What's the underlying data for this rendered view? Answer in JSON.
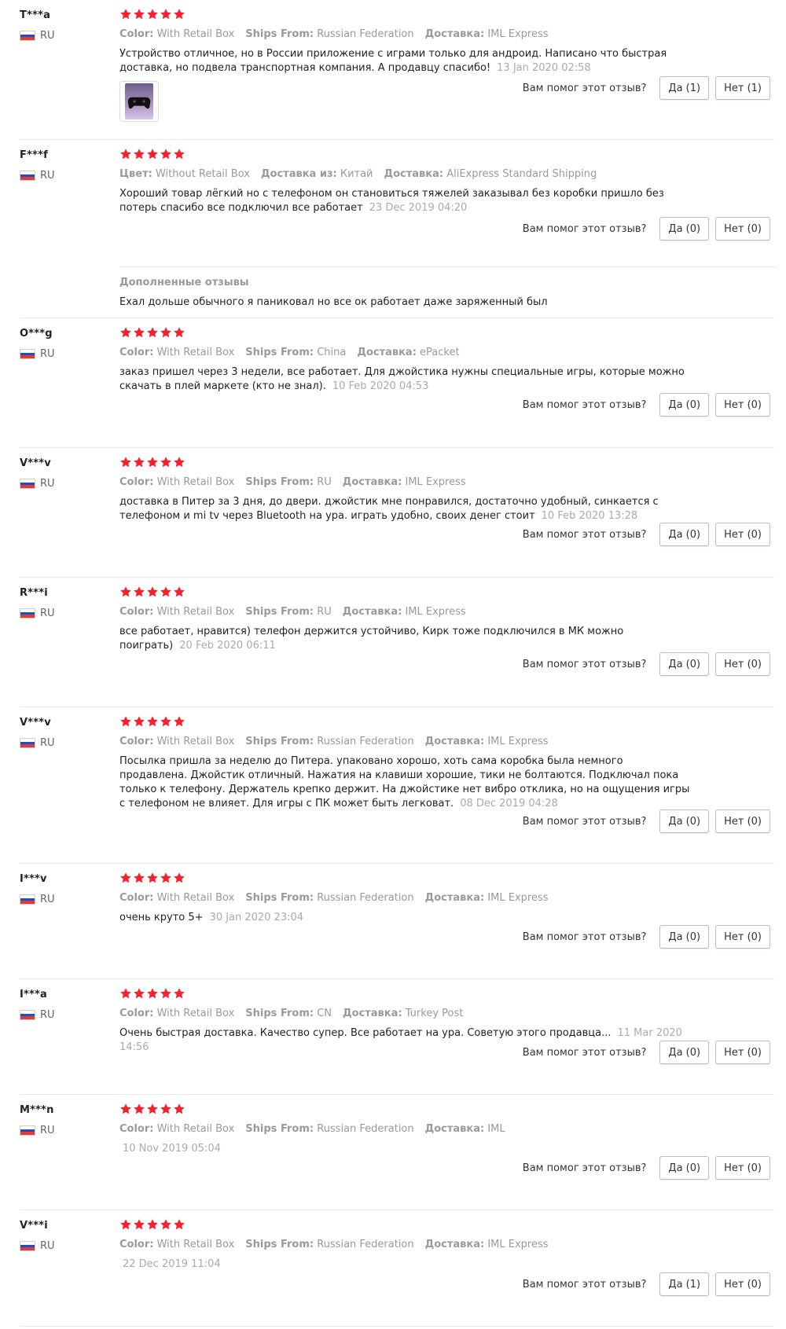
{
  "colors": {
    "star": "#f5222d",
    "meta": "#999999",
    "flag": [
      "#ffffff",
      "#1e4fbf",
      "#e53935"
    ]
  },
  "icons": {
    "star": "star-icon",
    "flag": "russia-flag-icon",
    "thumb": "gamepad-thumbnail"
  },
  "reviews": [
    {
      "author": "T***a",
      "country": "RU",
      "stars": 5,
      "meta": [
        {
          "label": "Color:",
          "value": "With Retail Box"
        },
        {
          "label": "Ships From:",
          "value": "Russian Federation"
        },
        {
          "label": "Доставка:",
          "value": "IML Express"
        }
      ],
      "text": "Устройство отличное, но в России приложение с играми только для андроид. Написано что быстрая доставка, но подвела транспортная компания. А продавцу спасибо!",
      "date": "13 Jan 2020 02:58",
      "has_image": true,
      "helpful_q": "Вам помог этот отзыв?",
      "yes": "Да (1)",
      "no": "Нет (1)"
    },
    {
      "author": "F***f",
      "country": "RU",
      "stars": 5,
      "meta": [
        {
          "label": "Цвет:",
          "value": "Without Retail Box"
        },
        {
          "label": "Доставка из:",
          "value": "Китай"
        },
        {
          "label": "Доставка:",
          "value": "AliExpress Standard Shipping"
        }
      ],
      "text": "Хороший товар лёгкий но с телефоном он становиться тяжелей заказывал без коробки пришло без потерь спасибо все подключил все работает",
      "date": "23 Dec 2019 04:20",
      "helpful_q": "Вам помог этот отзыв?",
      "yes": "Да (0)",
      "no": "Нет (0)",
      "additional": {
        "title": "Дополненные отзывы",
        "text": "Ехал дольше обычного я паниковал но все ок работает даже заряженный был"
      }
    },
    {
      "author": "O***g",
      "country": "RU",
      "stars": 5,
      "meta": [
        {
          "label": "Color:",
          "value": "With Retail Box"
        },
        {
          "label": "Ships From:",
          "value": "China"
        },
        {
          "label": "Доставка:",
          "value": "ePacket"
        }
      ],
      "text": "заказ пришел через 3 недели, все работает. Для джойстика нужны специальные игры, которые можно скачать в плей маркете (кто не знал).",
      "date": "10 Feb 2020 04:53",
      "helpful_q": "Вам помог этот отзыв?",
      "yes": "Да (0)",
      "no": "Нет (0)"
    },
    {
      "author": "V***v",
      "country": "RU",
      "stars": 5,
      "meta": [
        {
          "label": "Color:",
          "value": "With Retail Box"
        },
        {
          "label": "Ships From:",
          "value": "RU"
        },
        {
          "label": "Доставка:",
          "value": "IML Express"
        }
      ],
      "text": "доставка в Питер за 3 дня, до двери. джойстик мне понравился, достаточно удобный, синкается с телефоном и mi tv через Bluetooth на ура. играть удобно, своих денег стоит",
      "date": "10 Feb 2020 13:28",
      "helpful_q": "Вам помог этот отзыв?",
      "yes": "Да (0)",
      "no": "Нет (0)"
    },
    {
      "author": "R***i",
      "country": "RU",
      "stars": 5,
      "meta": [
        {
          "label": "Color:",
          "value": "With Retail Box"
        },
        {
          "label": "Ships From:",
          "value": "RU"
        },
        {
          "label": "Доставка:",
          "value": "IML Express"
        }
      ],
      "text": "все работает, нравится) телефон держится устойчиво, Кирк тоже подключился в МК можно поиграть)",
      "date": "20 Feb 2020 06:11",
      "helpful_q": "Вам помог этот отзыв?",
      "yes": "Да (0)",
      "no": "Нет (0)"
    },
    {
      "author": "V***v",
      "country": "RU",
      "stars": 5,
      "meta": [
        {
          "label": "Color:",
          "value": "With Retail Box"
        },
        {
          "label": "Ships From:",
          "value": "Russian Federation"
        },
        {
          "label": "Доставка:",
          "value": "IML Express"
        }
      ],
      "text": "Посылка пришла за неделю до Питера. упаковано хорошо, хоть сама коробка была немного продавлена. Джойстик отличный. Нажатия на клавиши хорошие, тики не болтаются. Подключал пока только к телефону. Держатель крепко держит. На джойстике нет вибро отклика, но на ощущения игры с телефоном не влияет. Для игры с ПК может быть легковат.",
      "date": "08 Dec 2019 04:28",
      "helpful_q": "Вам помог этот отзыв?",
      "yes": "Да (0)",
      "no": "Нет (0)"
    },
    {
      "author": "I***v",
      "country": "RU",
      "stars": 5,
      "meta": [
        {
          "label": "Color:",
          "value": "With Retail Box"
        },
        {
          "label": "Ships From:",
          "value": "Russian Federation"
        },
        {
          "label": "Доставка:",
          "value": "IML Express"
        }
      ],
      "text": "очень круто 5+",
      "date": "30 Jan 2020 23:04",
      "helpful_q": "Вам помог этот отзыв?",
      "yes": "Да (0)",
      "no": "Нет (0)"
    },
    {
      "author": "I***a",
      "country": "RU",
      "stars": 5,
      "meta": [
        {
          "label": "Color:",
          "value": "With Retail Box"
        },
        {
          "label": "Ships From:",
          "value": "CN"
        },
        {
          "label": "Доставка:",
          "value": "Turkey Post"
        }
      ],
      "text": "Очень быстрая доставка. Качество супер. Все работает на ура. Советую этого продавца...",
      "date": "11 Mar 2020 14:56",
      "helpful_q": "Вам помог этот отзыв?",
      "yes": "Да (0)",
      "no": "Нет (0)"
    },
    {
      "author": "M***n",
      "country": "RU",
      "stars": 5,
      "meta": [
        {
          "label": "Color:",
          "value": "With Retail Box"
        },
        {
          "label": "Ships From:",
          "value": "Russian Federation"
        },
        {
          "label": "Доставка:",
          "value": "IML"
        }
      ],
      "text": "",
      "date": "10 Nov 2019 05:04",
      "helpful_q": "Вам помог этот отзыв?",
      "yes": "Да (0)",
      "no": "Нет (0)"
    },
    {
      "author": "V***i",
      "country": "RU",
      "stars": 5,
      "meta": [
        {
          "label": "Color:",
          "value": "With Retail Box"
        },
        {
          "label": "Ships From:",
          "value": "Russian Federation"
        },
        {
          "label": "Доставка:",
          "value": "IML Express"
        }
      ],
      "text": "",
      "date": "22 Dec 2019 11:04",
      "helpful_q": "Вам помог этот отзыв?",
      "yes": "Да (1)",
      "no": "Нет (0)"
    }
  ]
}
